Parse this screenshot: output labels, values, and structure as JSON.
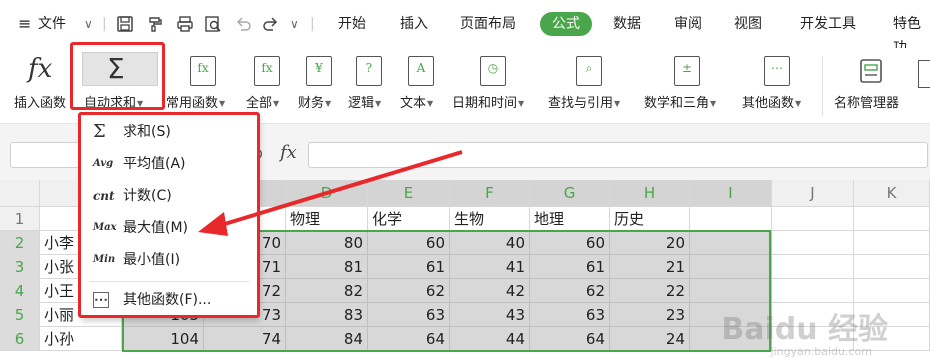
{
  "menubar": {
    "menu_label": "文件",
    "tabs": [
      "开始",
      "插入",
      "页面布局",
      "公式",
      "数据",
      "审阅",
      "视图",
      "开发工具",
      "特色功"
    ],
    "active_tab": "公式"
  },
  "ribbon": {
    "insert_function": "插入函数",
    "autosum": "自动求和",
    "common": "常用函数",
    "all": "全部",
    "finance": "财务",
    "logic": "逻辑",
    "text": "文本",
    "datetime": "日期和时间",
    "lookup": "查找与引用",
    "math": "数学和三角",
    "other": "其他函数",
    "name_manager": "名称管理器"
  },
  "formula_bar": {
    "fx": "fx"
  },
  "dropdown": {
    "items": [
      {
        "icon": "Σ",
        "label": "求和(S)"
      },
      {
        "icon": "Avg",
        "label": "平均值(A)"
      },
      {
        "icon": "cnt",
        "label": "计数(C)"
      },
      {
        "icon": "Max",
        "label": "最大值(M)"
      },
      {
        "icon": "Min",
        "label": "最小值(I)"
      },
      {
        "icon": "⋯",
        "label": "其他函数(F)..."
      }
    ]
  },
  "grid": {
    "col_headers": [
      "D",
      "E",
      "F",
      "G",
      "H",
      "I",
      "J",
      "K"
    ],
    "row_headers": [
      "1",
      "2",
      "3",
      "4",
      "5",
      "6"
    ],
    "header_row": [
      "物理",
      "化学",
      "生物",
      "地理",
      "历史"
    ],
    "rows": [
      {
        "name": "小李",
        "b": "",
        "c": "70",
        "d": "80",
        "e": "60",
        "f": "40",
        "g": "60",
        "h": "20"
      },
      {
        "name": "小张",
        "b": "",
        "c": "71",
        "d": "81",
        "e": "61",
        "f": "41",
        "g": "61",
        "h": "21"
      },
      {
        "name": "小王",
        "b": "",
        "c": "72",
        "d": "82",
        "e": "62",
        "f": "42",
        "g": "62",
        "h": "22"
      },
      {
        "name": "小丽",
        "b": "103",
        "c": "73",
        "d": "83",
        "e": "63",
        "f": "43",
        "g": "63",
        "h": "23"
      },
      {
        "name": "小孙",
        "b": "104",
        "c": "74",
        "d": "84",
        "e": "64",
        "f": "44",
        "g": "64",
        "h": "24"
      }
    ]
  },
  "watermark": {
    "brand": "Baidu 经验",
    "url": "jingyan.baidu.com"
  },
  "colors": {
    "accent_green": "#4aa64a",
    "highlight_red": "#e8282b",
    "selection_gray": "#d8d8d8"
  }
}
